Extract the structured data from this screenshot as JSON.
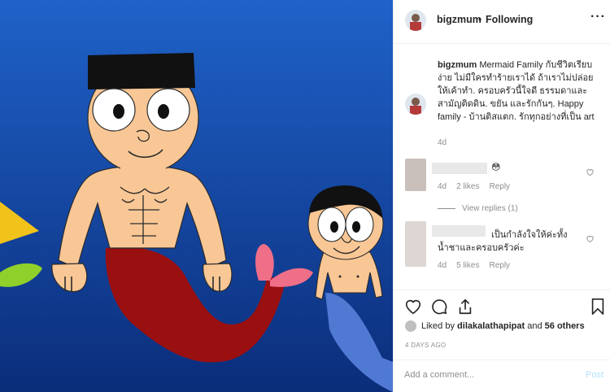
{
  "post": {
    "username": "bigzmum",
    "separator": "•",
    "follow_status": "Following",
    "more_icon": "more-options-icon"
  },
  "caption": {
    "username": "bigzmum",
    "text": "Mermaid Family กับชีวิตเรียบง่าย ไม่มีใครทำร้ายเราได้ ถ้าเราไม่ปล่อยให้เค้าทำ. ครอบครัวนี้ใจดี ธรรมดาและสามัญติดดิน. ขยัน และรักกันๆ. Happy family - บ้านติสแตก. รักทุกอย่างที่เป็น art",
    "time": "4d"
  },
  "comments": [
    {
      "text": "😳",
      "time": "4d",
      "likes": "2 likes",
      "reply": "Reply",
      "view_replies": "View replies (1)"
    },
    {
      "text": "เป็นกำลังใจให้ค่ะทั้งน้ำชาและครอบครัวค่ะ",
      "time": "4d",
      "likes": "5 likes",
      "reply": "Reply"
    }
  ],
  "actions": {
    "like_icon": "heart-icon",
    "comment_icon": "comment-icon",
    "share_icon": "share-icon",
    "save_icon": "bookmark-icon"
  },
  "likes": {
    "prefix": "Liked by",
    "user": "dilakalathapipat",
    "middle": "and",
    "others": "56 others"
  },
  "date": "4 DAYS AGO",
  "add_comment": {
    "placeholder": "Add a comment...",
    "post_label": "Post"
  },
  "colors": {
    "photo_bg_top": "#1d5fc6",
    "photo_bg_bottom": "#0b2f7e",
    "skin": "#f9c795",
    "tail_red": "#9a0f10",
    "tail_blue": "#4f79d3",
    "fin_pink": "#ef6f88"
  }
}
